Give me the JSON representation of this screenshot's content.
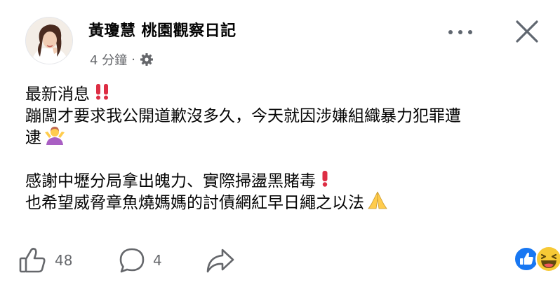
{
  "post": {
    "author": "黃瓊慧 桃園觀察日記",
    "time": "4 分鐘",
    "dot": "·",
    "icons": {
      "privacy": "gear-icon",
      "more": "more-dots-icon",
      "close": "close-icon"
    }
  },
  "content": {
    "line1": "最新消息",
    "line1_emoji": "double-exclamation-icon",
    "line2": "蹦闆才要求我公開道歉沒多久，今天就因涉嫌組織暴力犯罪遭",
    "line3": "逮",
    "line3_emoji": "person-shrugging-icon",
    "line4": "感謝中壢分局拿出魄力、實際掃盪黑賭毒",
    "line4_emoji": "exclamation-icon",
    "line5": "也希望威脅章魚燒媽媽的討債網紅早日繩之以法",
    "line5_emoji": "folded-hands-icon"
  },
  "actions": {
    "like_count": "48",
    "comment_count": "4",
    "icons": {
      "like": "thumbs-up-icon",
      "comment": "comment-bubble-icon",
      "share": "share-arrow-icon"
    }
  },
  "reactions": {
    "icons": [
      "like-reaction-icon",
      "haha-reaction-icon"
    ],
    "like_color": "#1877f2",
    "haha_color": "#f7c936"
  }
}
